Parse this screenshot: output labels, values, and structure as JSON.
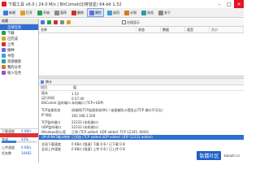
{
  "titlebar": {
    "title": "下载工具 v6.0 | 24.0 M/s | BitComet(比特彗星) 64-bit 1.52"
  },
  "toolbar": {
    "buttons": [
      {
        "label": "新建",
        "color": "#3a7de0"
      },
      {
        "label": "打开",
        "color": "#e0a020"
      },
      {
        "label": "开始",
        "color": "#25a04a"
      },
      {
        "label": "暂停",
        "color": "#8a8a8a"
      },
      {
        "label": "删除",
        "color": "#d03030"
      },
      {
        "label": "属性",
        "color": "#6a6ae0",
        "active": true
      },
      {
        "label": "选项",
        "color": "#3aa0d0"
      },
      {
        "label": "计划",
        "color": "#d07a20"
      },
      {
        "label": "浏览",
        "color": "#2f9a9a"
      },
      {
        "label": "关于",
        "color": "#888888"
      }
    ]
  },
  "sidebar": {
    "header": "收藏",
    "items": [
      {
        "label": "全部任务",
        "color": "#2f6fd0",
        "selected": true
      },
      {
        "label": "下载",
        "color": "#25a04a"
      },
      {
        "label": "已完成",
        "color": "#e0a020"
      },
      {
        "label": "上传",
        "color": "#d03030"
      },
      {
        "label": "做种",
        "color": "#6a6ae0"
      },
      {
        "label": "书签",
        "color": "#3aa0d0"
      },
      {
        "label": "资源搜索",
        "color": "#2f9a9a"
      },
      {
        "label": "我的分享",
        "color": "#d07a20"
      },
      {
        "label": "收入任务",
        "color": "#8a5ad0"
      }
    ],
    "status": {
      "speed_down_label": "下载速度",
      "speed_down": "0 KB/s",
      "speed_up_label": "上传速度",
      "speed_up": "0 KB/s",
      "tasks_label": "任务数",
      "tasks": "34482",
      "ratio_label": "完成",
      "ratio": "43%",
      "progress": 0.43
    }
  },
  "main": {
    "subtool": {
      "icons": [
        "#3a7de0",
        "#25a04a",
        "#d03030",
        "#8a8a8a",
        "#e0a020"
      ],
      "check_label": "分组显示"
    },
    "columns": [
      "名称",
      "状态",
      "数据",
      "类型",
      "大小"
    ],
    "detail_tab": "统计",
    "detail_cols": [
      "项目",
      "值"
    ],
    "rows": [
      {
        "k": "版本",
        "v": "1.52"
      },
      {
        "k": "运行时间",
        "v": "0:37:40"
      },
      {
        "k": "BitComet 监听端口",
        "v": "本机端口 (TCP+UDP)"
      },
      {
        "k": "",
        "v": ""
      },
      {
        "k": "TCP连接状态",
        "v": "局域网(TCP连接状态OK) / 连接被防火墙阻止(TCP 端口不可达)"
      },
      {
        "k": "IP 地址",
        "v": "192.168.1.100"
      },
      {
        "k": "",
        "v": ""
      },
      {
        "k": "TCP监听端口",
        "v": "22233 (本机端口)"
      },
      {
        "k": "UDP监听端口",
        "v": "22233 (本机端口)"
      },
      {
        "k": "Windows防火墙",
        "v": "正常 (TCP added: UDP added: TCP 12345, 6000)"
      },
      {
        "k": "UPnP/NAT端口映射",
        "v": "已添加 (TCP added UDP added: UDP 22233 added)",
        "selected": true
      },
      {
        "k": "",
        "v": ""
      },
      {
        "k": "全局下载速度",
        "v": "0 KB/s (限速) 下载 0 B / 已下载 0 B"
      },
      {
        "k": "全局上传速度",
        "v": "0 KB/s (限速) 上传 0 B / 已上传 0 B"
      }
    ]
  },
  "watermark": {
    "badge": "骷髅社区",
    "url": "kulouit.cn"
  }
}
